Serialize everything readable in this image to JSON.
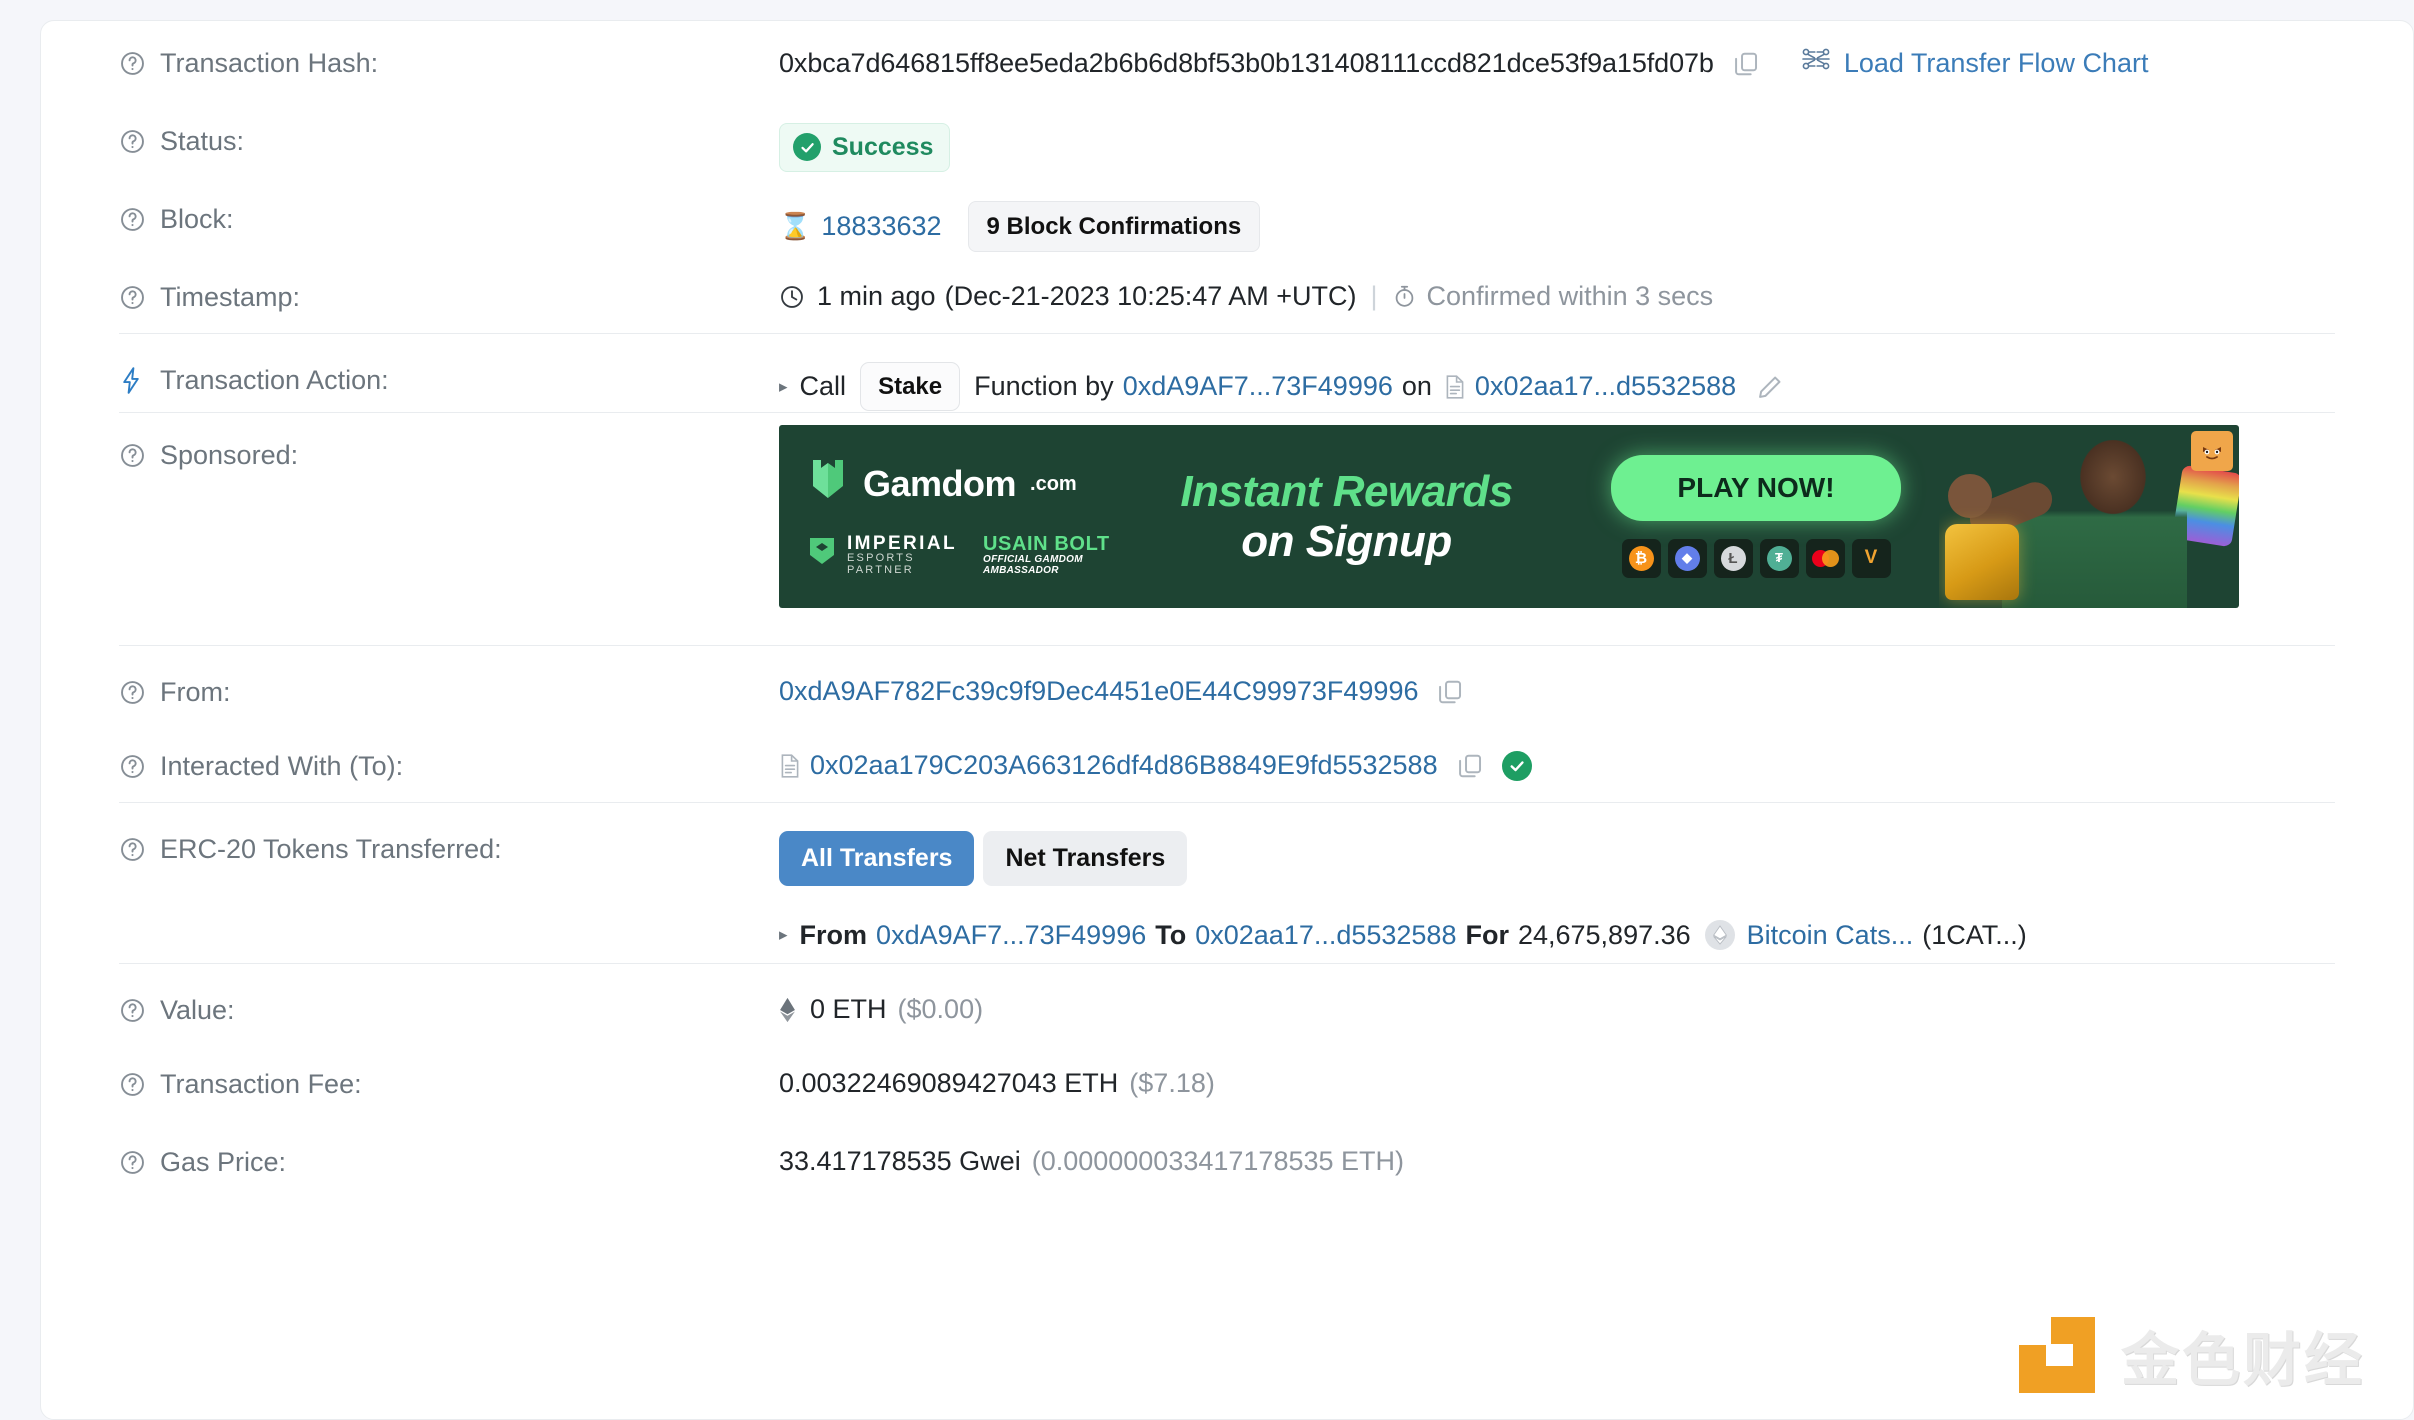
{
  "labels": {
    "transaction_hash": "Transaction Hash:",
    "status": "Status:",
    "block": "Block:",
    "timestamp": "Timestamp:",
    "transaction_action": "Transaction Action:",
    "sponsored": "Sponsored:",
    "from": "From:",
    "interacted_with": "Interacted With (To):",
    "erc20_transferred": "ERC-20 Tokens Transferred:",
    "value": "Value:",
    "transaction_fee": "Transaction Fee:",
    "gas_price": "Gas Price:"
  },
  "transaction_hash": {
    "value": "0xbca7d646815ff8ee5eda2b6b6d8bf53b0b131408111ccd821dce53f9a15fd07b",
    "copy_icon": "copy-icon",
    "flow_chart_link": "Load Transfer Flow Chart",
    "flow_chart_icon": "flow-chart-icon"
  },
  "status": {
    "text": "Success",
    "icon": "check-circle-icon",
    "color": "#1f8a5f",
    "background": "#eefaf4"
  },
  "block": {
    "icon": "hourglass-icon",
    "number": "18833632",
    "confirmations": "9 Block Confirmations"
  },
  "timestamp": {
    "clock_icon": "clock-icon",
    "relative": "1 min ago",
    "absolute": "(Dec-21-2023 10:25:47 AM +UTC)",
    "separator": "|",
    "stopwatch_icon": "stopwatch-icon",
    "confirmed": "Confirmed within 3 secs"
  },
  "transaction_action": {
    "icon": "lightning-bolt-icon",
    "caret": "▸",
    "call_word": "Call",
    "function_name": "Stake",
    "function_word": "Function by",
    "by_address": "0xdA9AF7...73F49996",
    "on_word": "on",
    "contract_icon": "contract-document-icon",
    "on_address": "0x02aa17...d5532588",
    "edit_icon": "pencil-icon"
  },
  "sponsored": {
    "brand": "Gamdom",
    "brand_suffix": ".com",
    "brand_icon": "gamdom-shield-icon",
    "partner_1_name": "IMPERIAL",
    "partner_1_sub": "ESPORTS PARTNER",
    "partner_1_icon": "imperial-shield-icon",
    "partner_2_name": "USAIN BOLT",
    "partner_2_sub": "OFFICIAL GAMDOM AMBASSADOR",
    "headline_line1": "Instant Rewards",
    "headline_line2": "on Signup",
    "cta": "PLAY NOW!",
    "coins": [
      {
        "name": "bitcoin-icon",
        "symbol": "₿",
        "color": "#f7931a"
      },
      {
        "name": "ethereum-icon",
        "symbol": "◆",
        "color": "#627eea"
      },
      {
        "name": "litecoin-icon",
        "symbol": "Ł",
        "color": "#d6d9dc"
      },
      {
        "name": "tether-icon",
        "symbol": "₮",
        "color": "#50af95"
      },
      {
        "name": "mastercard-icon",
        "symbol": "",
        "color": "#eb001b"
      },
      {
        "name": "verve-icon",
        "symbol": "V",
        "color": "#f0a330"
      }
    ],
    "background": "#1e4433",
    "accent": "#6ef091"
  },
  "from": {
    "address": "0xdA9AF782Fc39c9f9Dec4451e0E44C99973F49996",
    "copy_icon": "copy-icon"
  },
  "interacted_with": {
    "contract_icon": "contract-document-icon",
    "address": "0x02aa179C203A663126df4d86B8849E9fd5532588",
    "copy_icon": "copy-icon",
    "verified_icon": "verified-check-icon"
  },
  "erc20": {
    "tabs": [
      {
        "label": "All Transfers",
        "active": true
      },
      {
        "label": "Net Transfers",
        "active": false
      }
    ],
    "transfer": {
      "caret": "▸",
      "from_word": "From",
      "from_address": "0xdA9AF7...73F49996",
      "to_word": "To",
      "to_address": "0x02aa17...d5532588",
      "for_word": "For",
      "amount": "24,675,897.36",
      "token_icon": "token-icon",
      "token_name": "Bitcoin Cats...",
      "token_symbol": "(1CAT...)"
    }
  },
  "value": {
    "eth_icon": "ethereum-diamond-icon",
    "amount": "0 ETH",
    "fiat": "($0.00)"
  },
  "transaction_fee": {
    "amount": "0.00322469089427043 ETH",
    "fiat": "($7.18)"
  },
  "gas_price": {
    "gwei": "33.417178535 Gwei",
    "eth": "(0.000000033417178535 ETH)"
  },
  "watermark": {
    "text": "金色财经",
    "logo": "jinse-logo-icon",
    "color": "#f0a024"
  }
}
